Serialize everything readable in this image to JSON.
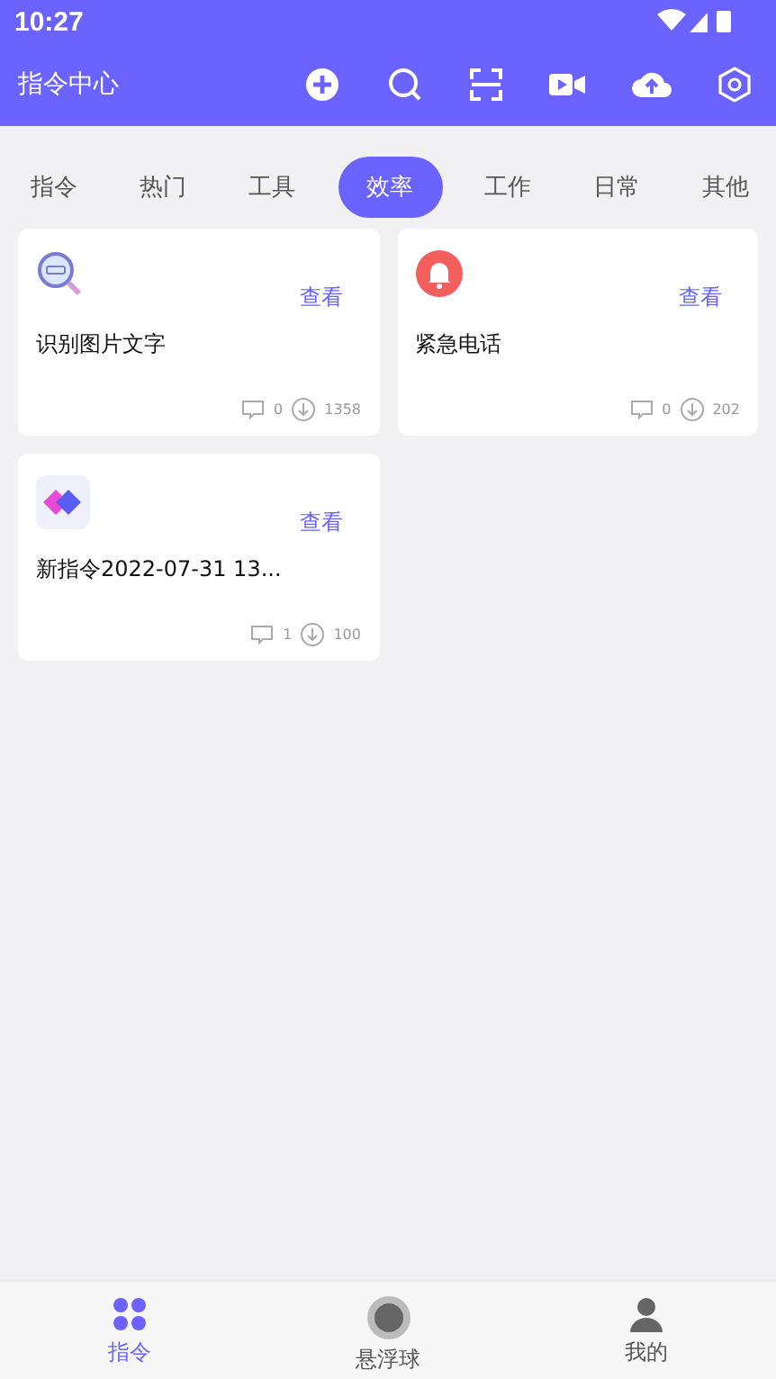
{
  "status_bar": {
    "time": "10:27"
  },
  "app_bar": {
    "title": "指令中心"
  },
  "tabs": [
    {
      "label": "指令",
      "selected": false
    },
    {
      "label": "热门",
      "selected": false
    },
    {
      "label": "工具",
      "selected": false
    },
    {
      "label": "效率",
      "selected": true
    },
    {
      "label": "工作",
      "selected": false
    },
    {
      "label": "日常",
      "selected": false
    },
    {
      "label": "其他",
      "selected": false
    }
  ],
  "cards": [
    {
      "kind": "ocr",
      "title": "识别图片文字",
      "action": "查看",
      "comments": "0",
      "downloads": "1358"
    },
    {
      "kind": "bell",
      "title": "紧急电话",
      "action": "查看",
      "comments": "0",
      "downloads": "202"
    },
    {
      "kind": "diamonds",
      "title": "新指令2022-07-31 13...",
      "action": "查看",
      "comments": "1",
      "downloads": "100"
    }
  ],
  "bottom_nav": [
    {
      "kind": "grid",
      "label": "指令",
      "selected": true
    },
    {
      "kind": "ball",
      "label": "悬浮球",
      "selected": false
    },
    {
      "kind": "person",
      "label": "我的",
      "selected": false
    }
  ]
}
